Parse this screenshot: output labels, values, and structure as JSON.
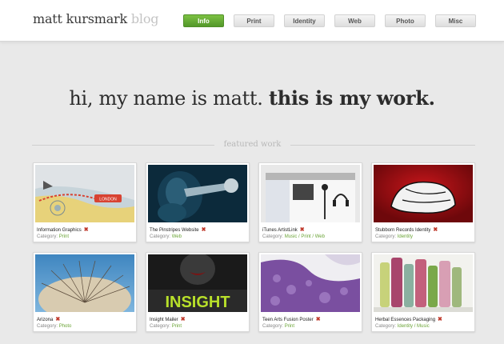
{
  "header": {
    "logo_name": "matt kursmark",
    "logo_sub": "blog"
  },
  "nav": {
    "items": [
      {
        "label": "Info",
        "active": true
      },
      {
        "label": "Print",
        "active": false
      },
      {
        "label": "Identity",
        "active": false
      },
      {
        "label": "Web",
        "active": false
      },
      {
        "label": "Photo",
        "active": false
      },
      {
        "label": "Misc",
        "active": false
      }
    ]
  },
  "hero": {
    "intro": "hi, my name is matt.",
    "emphasis": "this is my work."
  },
  "section": {
    "title": "featured work"
  },
  "cards": [
    {
      "title": "Information Graphics",
      "category_label": "Category:",
      "category": "Print"
    },
    {
      "title": "The Pinstripes Website",
      "category_label": "Category:",
      "category": "Web"
    },
    {
      "title": "iTunes ArtistLink",
      "category_label": "Category:",
      "category": "Music / Print / Web"
    },
    {
      "title": "Stubborn Records Identity",
      "category_label": "Category:",
      "category": "Identity"
    },
    {
      "title": "Arizona",
      "category_label": "Category:",
      "category": "Photo"
    },
    {
      "title": "Insight Mailer",
      "category_label": "Category:",
      "category": "Print"
    },
    {
      "title": "Teen Arts Fusion Poster",
      "category_label": "Category:",
      "category": "Print"
    },
    {
      "title": "Herbal Essences Packaging",
      "category_label": "Category:",
      "category": "Identity / Music"
    }
  ],
  "thumb_texts": {
    "infographic_label": "LONDON",
    "insight_word": "INSIGHT"
  },
  "colors": {
    "accent_green": "#64aa35",
    "remove_red": "#c0392b",
    "background": "#e9e9e9"
  },
  "icons": [
    "close-icon"
  ]
}
